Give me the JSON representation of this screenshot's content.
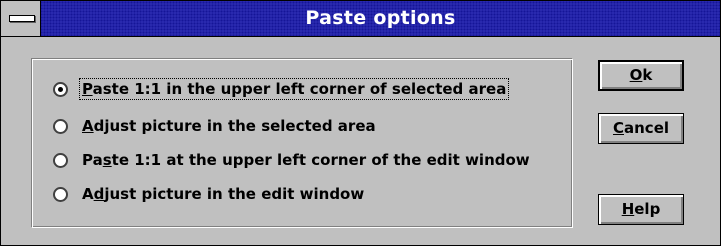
{
  "window": {
    "title": "Paste options"
  },
  "options": [
    {
      "pre": "",
      "ul": "P",
      "post": "aste 1:1 in the upper left corner of selected area",
      "checked": true,
      "focused": true
    },
    {
      "pre": "",
      "ul": "A",
      "post": "djust picture in the selected area",
      "checked": false,
      "focused": false
    },
    {
      "pre": "Pa",
      "ul": "s",
      "post": "te 1:1 at the upper left corner of the edit window",
      "checked": false,
      "focused": false
    },
    {
      "pre": "A",
      "ul": "d",
      "post": "just picture in the edit window",
      "checked": false,
      "focused": false
    }
  ],
  "buttons": {
    "ok": {
      "pre": "",
      "ul": "O",
      "post": "k"
    },
    "cancel": {
      "pre": "",
      "ul": "C",
      "post": "ancel"
    },
    "help": {
      "pre": "",
      "ul": "H",
      "post": "elp"
    }
  },
  "icons": {
    "system_menu": "system-menu-icon"
  },
  "colors": {
    "titlebar": "#2e2eb4",
    "dialog_bg": "#c0c0c0"
  }
}
